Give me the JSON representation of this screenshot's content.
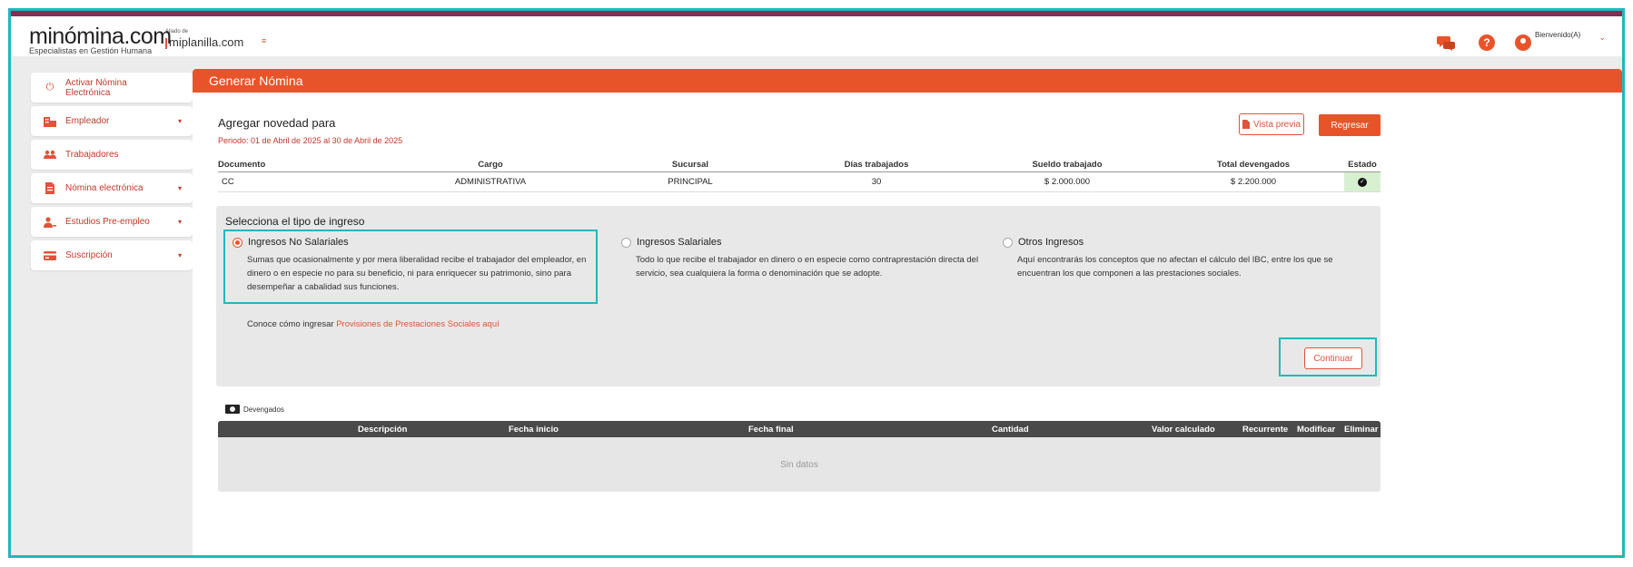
{
  "header": {
    "logo_name": "minómina.com",
    "logo_tagline": "Especialistas en Gestión Humana",
    "partner_small": "Aliado de",
    "partner_name": "miplanilla.com",
    "menu_toggle": "≡",
    "welcome": "Bienvenido(A)",
    "user_caret": "⌄",
    "help_glyph": "?"
  },
  "sidebar": {
    "items": [
      {
        "label": "Activar Nómina Electrónica",
        "icon": "power-icon",
        "has_caret": false
      },
      {
        "label": "Empleador",
        "icon": "building-icon",
        "has_caret": true
      },
      {
        "label": "Trabajadores",
        "icon": "users-icon",
        "has_caret": false
      },
      {
        "label": "Nómina electrónica",
        "icon": "document-icon",
        "has_caret": true
      },
      {
        "label": "Estudios Pre-empleo",
        "icon": "user-check-icon",
        "has_caret": true
      },
      {
        "label": "Suscripción",
        "icon": "card-icon",
        "has_caret": true
      }
    ],
    "caret": "▾"
  },
  "main": {
    "header_title": "Generar Nómina",
    "novedad_title": "Agregar novedad para",
    "periodo": "Periodo: 01 de Abril de 2025 al 30 de Abril de 2025",
    "vista_previa_label": "Vista previa",
    "regresar_label": "Regresar",
    "employee_table": {
      "headers": [
        "Documento",
        "Cargo",
        "Sucursal",
        "Días trabajados",
        "Sueldo trabajado",
        "Total devengados",
        "Estado"
      ],
      "row": {
        "documento": "CC",
        "cargo": "ADMINISTRATIVA",
        "sucursal": "PRINCIPAL",
        "dias": "30",
        "sueldo": "$ 2.000.000",
        "total": "$ 2.200.000",
        "estado_icon": "check-circle-icon"
      }
    },
    "tipo_ingreso": {
      "title": "Selecciona el tipo de ingreso",
      "options": [
        {
          "label": "Ingresos No Salariales",
          "selected": true,
          "description": "Sumas que ocasionalmente y por mera liberalidad recibe el trabajador del empleador, en dinero o en especie no para su beneficio, ni para enriquecer su patrimonio, sino para desempeñar a cabalidad sus funciones."
        },
        {
          "label": "Ingresos Salariales",
          "selected": false,
          "description": "Todo lo que recibe el trabajador en dinero o en especie como contraprestación directa del servicio, sea cualquiera la forma o denominación que se adopte."
        },
        {
          "label": "Otros Ingresos",
          "selected": false,
          "description": "Aquí encontrarás los conceptos que no afectan el cálculo del IBC, entre los que se encuentran los que componen a las prestaciones sociales."
        }
      ],
      "conoce_prefix": "Conoce cómo ingresar",
      "conoce_link": "Provisiones de Prestaciones Sociales aquí",
      "continuar_label": "Continuar"
    },
    "devengados": {
      "label": "Devengados",
      "headers": [
        "Descripción",
        "Fecha inicio",
        "Fecha final",
        "Cantidad",
        "Valor calculado",
        "Recurrente",
        "Modificar",
        "Eliminar"
      ],
      "empty_text": "Sin datos"
    }
  },
  "colors": {
    "accent": "#e8542a",
    "topbar_stripe": "#8b2a55",
    "highlight_outline": "#1fb8be",
    "table_header_dark": "#4a4a4a"
  }
}
